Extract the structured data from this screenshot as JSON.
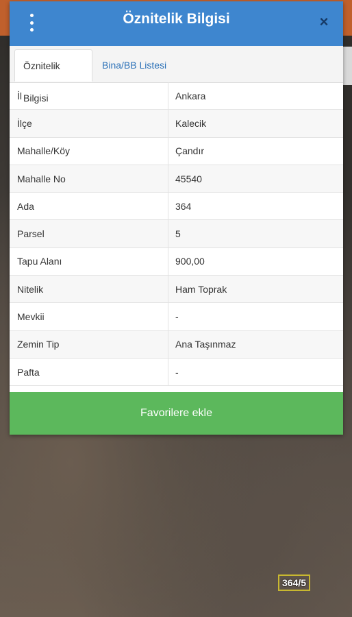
{
  "dialog": {
    "title": "Öznitelik Bilgisi",
    "menu_icon": "more-vertical-icon",
    "close_icon": "close-icon",
    "close_glyph": "×"
  },
  "tabs": [
    {
      "label": "Öznitelik Bilgisi",
      "active": true
    },
    {
      "label": "Bina/BB Listesi",
      "active": false
    }
  ],
  "attributes": [
    {
      "key": "İl",
      "value": "Ankara"
    },
    {
      "key": "İlçe",
      "value": "Kalecik"
    },
    {
      "key": "Mahalle/Köy",
      "value": "Çandır"
    },
    {
      "key": "Mahalle No",
      "value": "45540"
    },
    {
      "key": "Ada",
      "value": "364"
    },
    {
      "key": "Parsel",
      "value": "5"
    },
    {
      "key": "Tapu Alanı",
      "value": "900,00"
    },
    {
      "key": "Nitelik",
      "value": "Ham Toprak"
    },
    {
      "key": "Mevkii",
      "value": "-"
    },
    {
      "key": "Zemin Tip",
      "value": "Ana Taşınmaz"
    },
    {
      "key": "Pafta",
      "value": "-"
    }
  ],
  "favorite_button": {
    "label": "Favorilere ekle"
  },
  "map": {
    "parcel_label": "364/5"
  },
  "colors": {
    "header": "#3e86cf",
    "button": "#5cb85c",
    "tab_link": "#2d72b8",
    "top_bar": "#c0602c"
  }
}
